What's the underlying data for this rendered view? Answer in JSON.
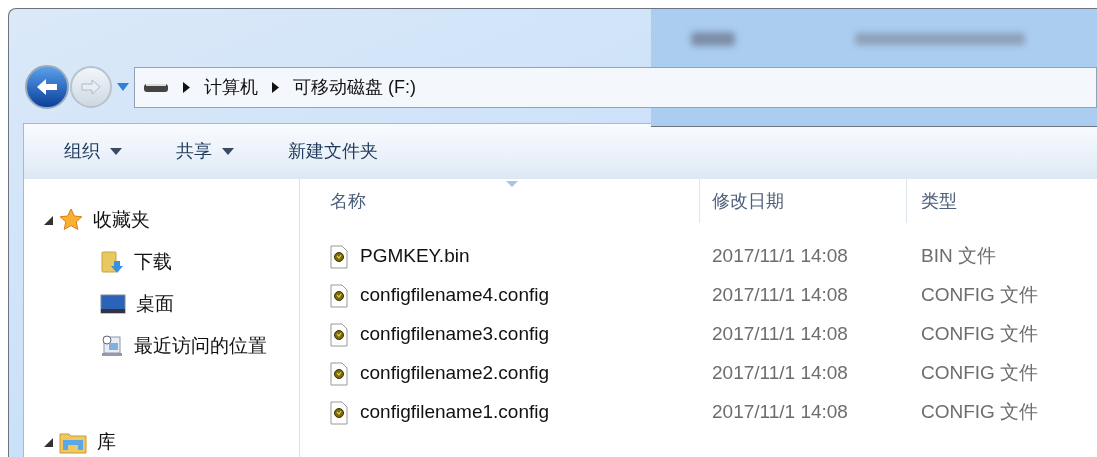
{
  "address_bar": {
    "crumbs": [
      "计算机",
      "可移动磁盘 (F:)"
    ]
  },
  "toolbar": [
    {
      "label": "组织",
      "dropdown": true
    },
    {
      "label": "共享",
      "dropdown": true
    },
    {
      "label": "新建文件夹",
      "dropdown": false
    }
  ],
  "sidebar": {
    "groups": [
      {
        "label": "收藏夹",
        "kind": "star",
        "expanded": true,
        "children": [
          {
            "label": "下载",
            "kind": "download"
          },
          {
            "label": "桌面",
            "kind": "desktop"
          },
          {
            "label": "最近访问的位置",
            "kind": "recent"
          }
        ]
      },
      {
        "label": "库",
        "kind": "library",
        "expanded": true
      }
    ]
  },
  "table": {
    "columns": [
      "名称",
      "修改日期",
      "类型"
    ],
    "rows": [
      {
        "name": "PGMKEY.bin",
        "date": "2017/11/1 14:08",
        "type": "BIN 文件"
      },
      {
        "name": "configfilename4.config",
        "date": "2017/11/1 14:08",
        "type": "CONFIG 文件"
      },
      {
        "name": "configfilename3.config",
        "date": "2017/11/1 14:08",
        "type": "CONFIG 文件"
      },
      {
        "name": "configfilename2.config",
        "date": "2017/11/1 14:08",
        "type": "CONFIG 文件"
      },
      {
        "name": "configfilename1.config",
        "date": "2017/11/1 14:08",
        "type": "CONFIG 文件"
      }
    ]
  }
}
